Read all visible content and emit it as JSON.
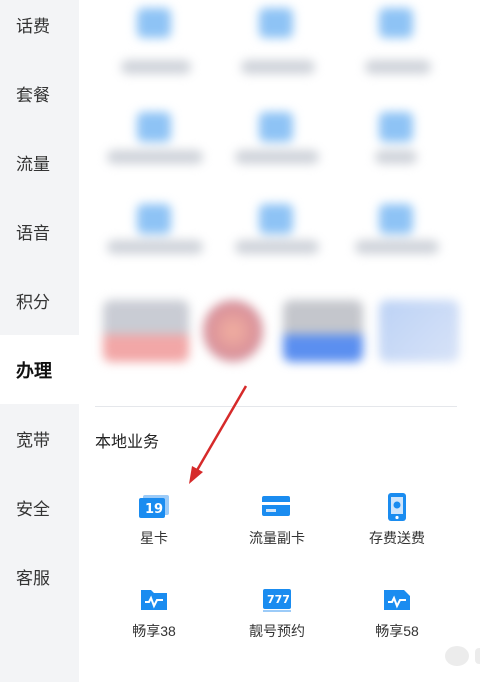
{
  "sidebar": {
    "items": [
      {
        "label": "话费",
        "active": false
      },
      {
        "label": "套餐",
        "active": false
      },
      {
        "label": "流量",
        "active": false
      },
      {
        "label": "语音",
        "active": false
      },
      {
        "label": "积分",
        "active": false
      },
      {
        "label": "办理",
        "active": true
      },
      {
        "label": "宽带",
        "active": false
      },
      {
        "label": "安全",
        "active": false
      },
      {
        "label": "客服",
        "active": false
      }
    ]
  },
  "section": {
    "title": "本地业务"
  },
  "services": [
    {
      "label": "星卡",
      "icon": "star-card-icon"
    },
    {
      "label": "流量副卡",
      "icon": "data-sub-card-icon"
    },
    {
      "label": "存费送费",
      "icon": "deposit-bonus-icon"
    },
    {
      "label": "畅享38",
      "icon": "unlimited-plan-icon"
    },
    {
      "label": "靓号预约",
      "icon": "vanity-number-icon"
    },
    {
      "label": "畅享58",
      "icon": "unlimited-plan-icon"
    }
  ],
  "colors": {
    "accent": "#1a8cf0",
    "sidebar_bg": "#f3f4f6",
    "annotation_arrow": "#d62a2a"
  }
}
